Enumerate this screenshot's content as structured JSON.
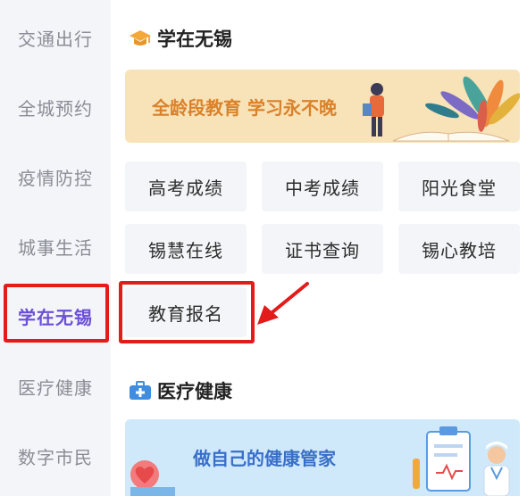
{
  "sidebar": {
    "items": [
      {
        "label": "交通出行",
        "active": false
      },
      {
        "label": "全城预约",
        "active": false
      },
      {
        "label": "疫情防控",
        "active": false
      },
      {
        "label": "城事生活",
        "active": false
      },
      {
        "label": "学在无锡",
        "active": true
      },
      {
        "label": "医疗健康",
        "active": false
      },
      {
        "label": "数字市民",
        "active": false
      }
    ]
  },
  "education": {
    "title": "学在无锡",
    "icon": "graduation-cap-icon",
    "banner_text": "全龄段教育 学习永不晚",
    "tiles": [
      "高考成绩",
      "中考成绩",
      "阳光食堂",
      "锡慧在线",
      "证书查询",
      "锡心教培",
      "教育报名"
    ]
  },
  "health": {
    "title": "医疗健康",
    "icon": "medical-kit-icon",
    "banner_text": "做自己的健康管家"
  },
  "colors": {
    "accent": "#6c4fd8",
    "highlight": "#e31b1b",
    "edu_banner_bg": "#f8e2b8",
    "edu_banner_text": "#d9822b",
    "health_banner_bg": "#cfe9fb",
    "health_banner_text": "#3a6fc7"
  }
}
